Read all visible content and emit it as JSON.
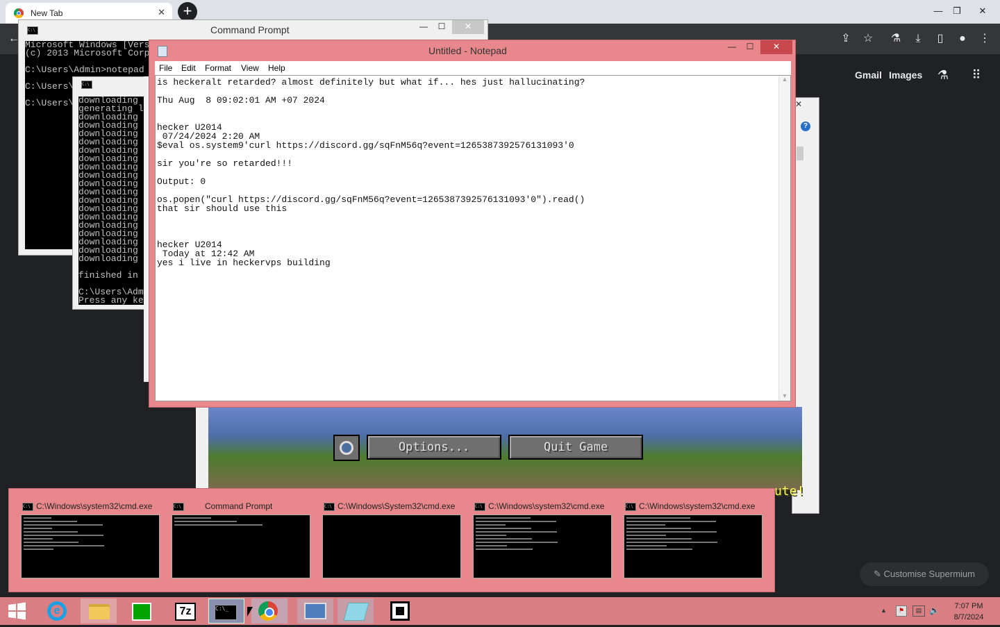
{
  "browser": {
    "tab_title": "New Tab",
    "tab_close": "✕",
    "new_tab": "+",
    "controls": {
      "minimize": "—",
      "restore": "❐",
      "close": "✕"
    },
    "links": {
      "gmail": "Gmail",
      "images": "Images"
    },
    "customise": "Customise Supermium",
    "back_icon": "←",
    "icons": [
      "share-icon",
      "star-icon",
      "labs-icon",
      "download-icon",
      "sidebar-icon",
      "profile-icon",
      "menu-icon"
    ]
  },
  "cmd_back": {
    "title": "Command Prompt",
    "lines": [
      "Microsoft Windows [Version",
      "(c) 2013 Microsoft Corpo",
      "",
      "C:\\Users\\Admin>notepad",
      "",
      "C:\\Users\\",
      "",
      "C:\\Users\\"
    ]
  },
  "cmd_mid": {
    "lines": [
      "downloading c",
      "generating la",
      "downloading j",
      "downloading j",
      "downloading j",
      "downloading j",
      "downloading",
      "downloading",
      "downloading",
      "downloading",
      "downloading",
      "downloading",
      "downloading",
      "downloading",
      "downloading",
      "downloading",
      "downloading",
      "downloading",
      "downloading",
      "downloading",
      "",
      "finished in",
      "",
      "C:\\Users\\Adm",
      "Press any ke"
    ]
  },
  "notepad": {
    "title": "Untitled - Notepad",
    "menu": [
      "File",
      "Edit",
      "Format",
      "View",
      "Help"
    ],
    "lines": [
      "is heckeralt retarded? almost definitely but what if... hes just hallucinating?",
      "",
      "Thu Aug  8 09:02:01 AM +07 2024",
      "",
      "",
      "hecker U2014",
      " 07/24/2024 2:20 AM",
      "$eval os.system9'curl https://discord.gg/sqFnM56q?event=1265387392576131093'0",
      "",
      "sir you're so retarded!!!",
      "",
      "Output: 0",
      "",
      "os.popen(\"curl https://discord.gg/sqFnM56q?event=1265387392576131093'0\").read()",
      "that sir should use this",
      "",
      "",
      "",
      "hecker U2014",
      " Today at 12:42 AM",
      "yes i live in heckervps building"
    ]
  },
  "minecraft": {
    "options": "Options...",
    "quit": "Quit Game",
    "splash": "ute!"
  },
  "thumbnails": [
    {
      "title": "C:\\Windows\\system32\\cmd.exe"
    },
    {
      "title": "Command Prompt"
    },
    {
      "title": "C:\\Windows\\System32\\cmd.exe"
    },
    {
      "title": "C:\\Windows\\system32\\cmd.exe"
    },
    {
      "title": "C:\\Windows\\system32\\cmd.exe"
    }
  ],
  "taskbar": {
    "apps": [
      "start-button",
      "internet-explorer-icon",
      "file-explorer-icon",
      "store-icon",
      "7zip-icon",
      "cmd-icon",
      "chrome-icon",
      "remote-desktop-icon",
      "notepad-icon",
      "minecraft-icon"
    ],
    "sevenzip_label": "7z",
    "time": "7:07 PM",
    "date": "8/7/2024",
    "tray_up": "▲"
  }
}
